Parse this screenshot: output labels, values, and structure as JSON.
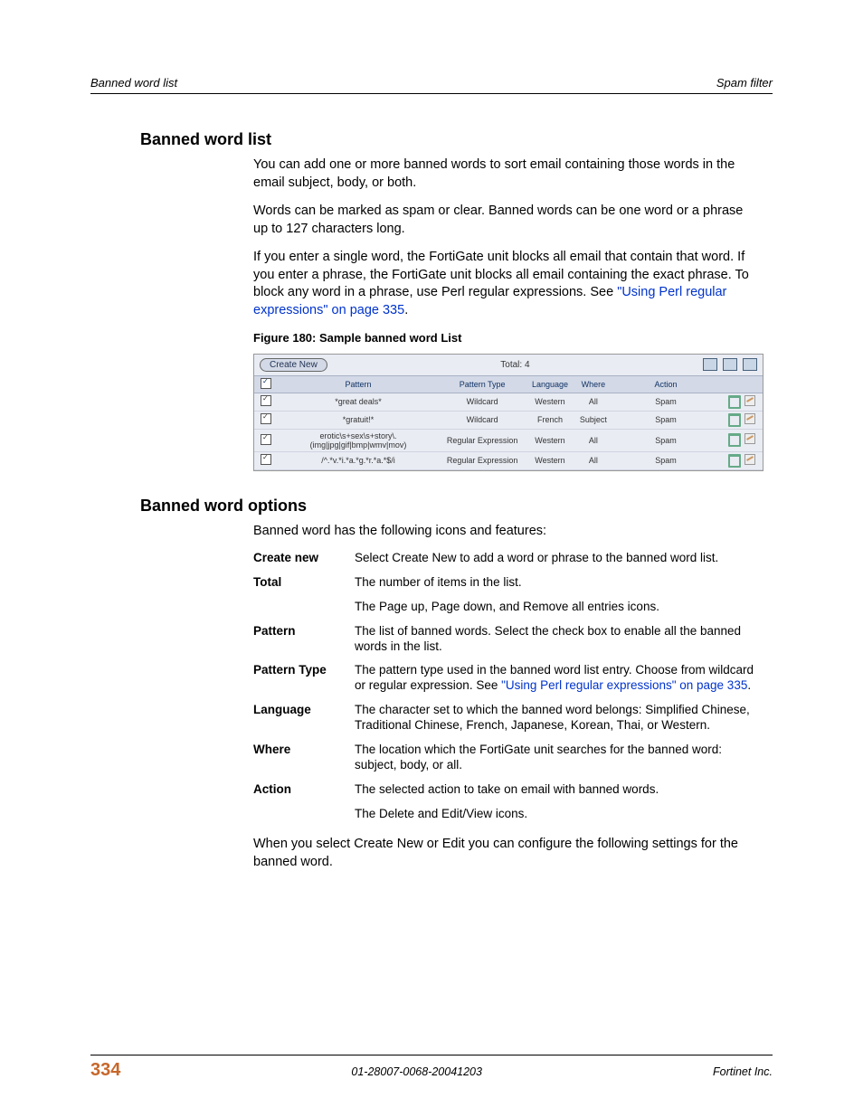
{
  "header": {
    "left": "Banned word list",
    "right": "Spam filter"
  },
  "sec1": {
    "title": "Banned word list",
    "p1": "You can add one or more banned words to sort email containing those words in the email subject, body, or both.",
    "p2": "Words can be marked as spam or clear. Banned words can be one word or a phrase up to 127 characters long.",
    "p3a": "If you enter a single word, the FortiGate unit blocks all email that contain that word. If you enter a phrase, the FortiGate unit blocks all email containing the exact phrase. To block any word in a phrase, use Perl regular expressions. See ",
    "p3link": "\"Using Perl regular expressions\" on page 335",
    "p3b": "."
  },
  "figure": {
    "caption": "Figure 180: Sample banned word List",
    "create": "Create New",
    "total": "Total: 4",
    "cols": {
      "pattern": "Pattern",
      "type": "Pattern Type",
      "lang": "Language",
      "where": "Where",
      "action": "Action"
    },
    "rows": [
      {
        "pattern": "*great deals*",
        "type": "Wildcard",
        "lang": "Western",
        "where": "All",
        "action": "Spam"
      },
      {
        "pattern": "*gratuit!*",
        "type": "Wildcard",
        "lang": "French",
        "where": "Subject",
        "action": "Spam"
      },
      {
        "pattern": "erotic\\s+sex\\s+story\\.(img|jpg|gif|bmp|wmv|mov)",
        "type": "Regular Expression",
        "lang": "Western",
        "where": "All",
        "action": "Spam"
      },
      {
        "pattern": "/^.*v.*i.*a.*g.*r.*a.*$/i",
        "type": "Regular Expression",
        "lang": "Western",
        "where": "All",
        "action": "Spam"
      }
    ]
  },
  "sec2": {
    "title": "Banned word options",
    "intro": "Banned word has the following icons and features:",
    "rows": [
      {
        "label": "Create new",
        "desc": "Select Create New to add a word or phrase to the banned word list."
      },
      {
        "label": "Total",
        "desc": "The number of items in the list."
      },
      {
        "label": "",
        "desc": "The Page up, Page down, and Remove all entries icons."
      },
      {
        "label": "Pattern",
        "desc": "The list of banned words. Select the check box to enable all the banned words in the list."
      },
      {
        "label": "Pattern Type",
        "desc_a": "The pattern type used in the banned word list entry. Choose from wildcard or regular expression. See ",
        "link": "\"Using Perl regular expressions\" on page 335",
        "desc_b": "."
      },
      {
        "label": "Language",
        "desc": "The character set to which the banned word belongs: Simplified Chinese, Traditional Chinese, French, Japanese, Korean, Thai, or Western."
      },
      {
        "label": "Where",
        "desc": "The location which the FortiGate unit searches for the banned word: subject, body, or all."
      },
      {
        "label": "Action",
        "desc": "The selected action to take on email with banned words."
      },
      {
        "label": "",
        "desc": "The Delete and Edit/View icons."
      }
    ],
    "closing": "When you select Create New or Edit you can configure the following settings for the banned word."
  },
  "footer": {
    "page": "334",
    "docid": "01-28007-0068-20041203",
    "company": "Fortinet Inc."
  }
}
